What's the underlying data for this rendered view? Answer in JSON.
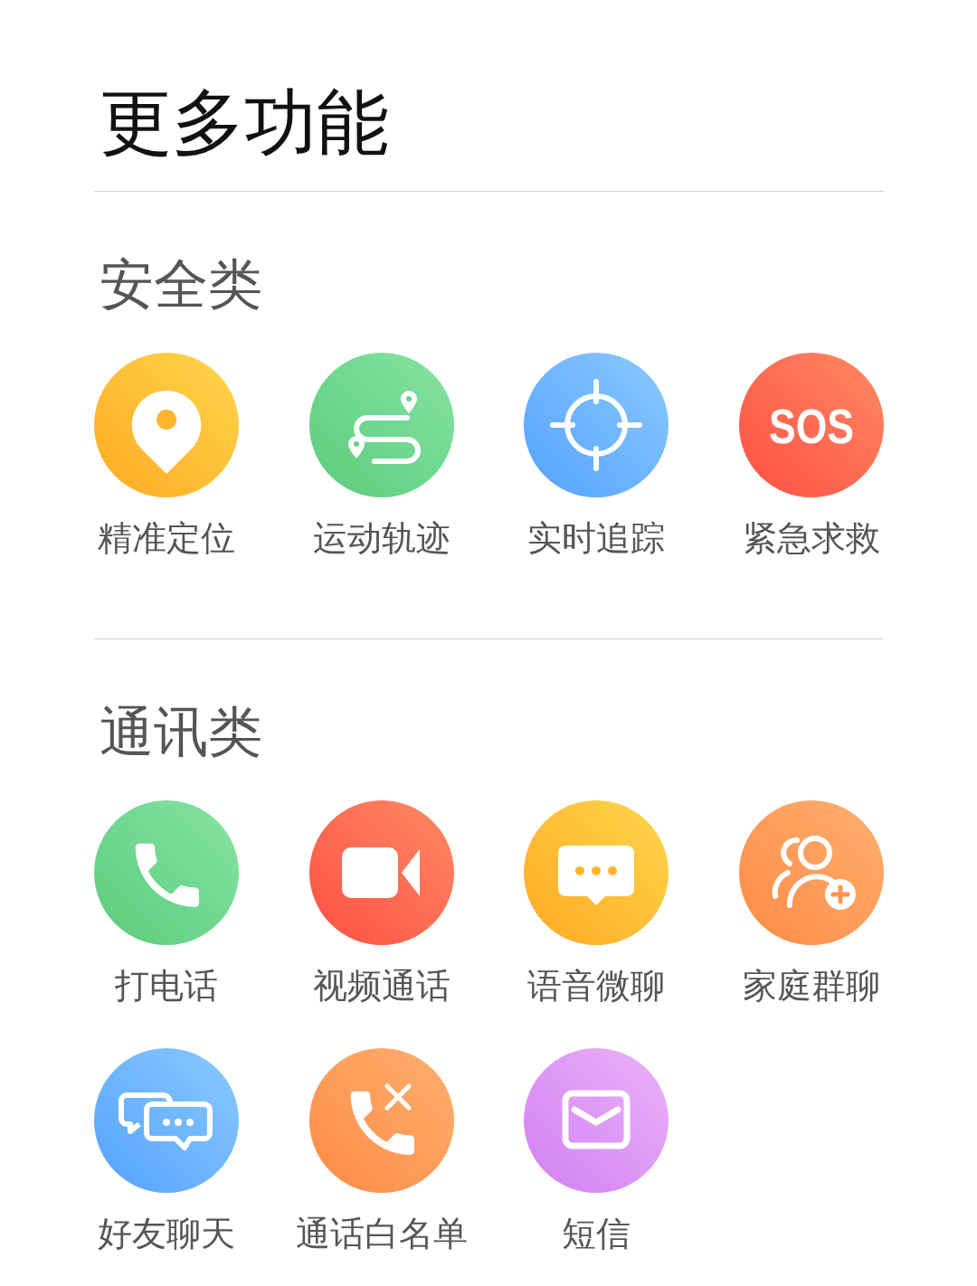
{
  "title": "更多功能",
  "sections": [
    {
      "title": "安全类",
      "items": [
        {
          "label": "精准定位",
          "kind": "pin"
        },
        {
          "label": "运动轨迹",
          "kind": "route"
        },
        {
          "label": "实时追踪",
          "kind": "target"
        },
        {
          "label": "紧急求救",
          "kind": "sos",
          "glyph": "SOS"
        }
      ]
    },
    {
      "title": "通讯类",
      "items": [
        {
          "label": "打电话",
          "kind": "phone"
        },
        {
          "label": "视频通话",
          "kind": "video"
        },
        {
          "label": "语音微聊",
          "kind": "chat"
        },
        {
          "label": "家庭群聊",
          "kind": "group"
        },
        {
          "label": "好友聊天",
          "kind": "friends"
        },
        {
          "label": "通话白名单",
          "kind": "blockcall"
        },
        {
          "label": "短信",
          "kind": "sms"
        }
      ]
    }
  ]
}
